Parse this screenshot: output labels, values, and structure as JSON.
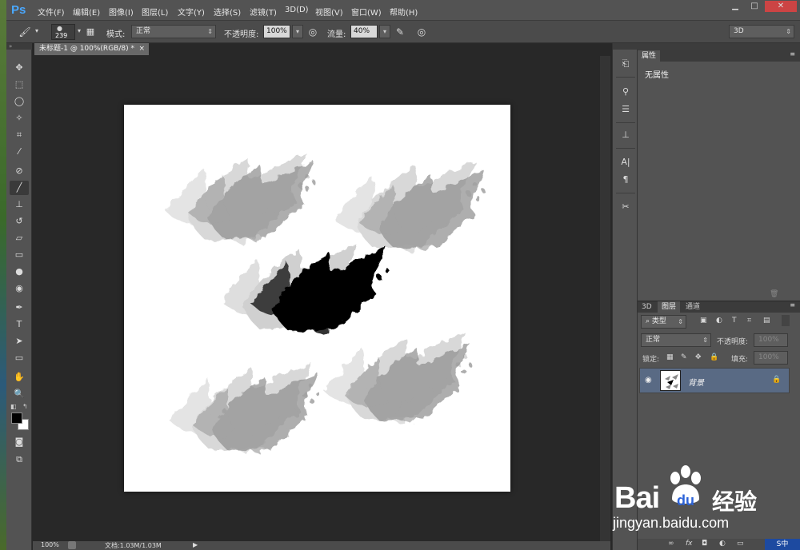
{
  "menu": {
    "logo": "Ps",
    "items": [
      "文件(F)",
      "编辑(E)",
      "图像(I)",
      "图层(L)",
      "文字(Y)",
      "选择(S)",
      "滤镜(T)",
      "3D(D)",
      "视图(V)",
      "窗口(W)",
      "帮助(H)"
    ]
  },
  "window_controls": {
    "minimize": "▁",
    "maximize": "□",
    "close": "✕"
  },
  "options": {
    "brush_size": "239",
    "mode_label": "模式:",
    "mode_value": "正常",
    "opacity_label": "不透明度:",
    "opacity_value": "100%",
    "flow_label": "流量:",
    "flow_value": "40%",
    "workspace": "3D"
  },
  "document": {
    "tab_title": "未标题-1 @ 100%(RGB/8) *",
    "close": "×"
  },
  "status": {
    "zoom": "100%",
    "doc_info": "文档:1.03M/1.03M"
  },
  "properties_panel": {
    "tab": "属性",
    "content": "无属性"
  },
  "layers_panel": {
    "tabs": [
      "3D",
      "图层",
      "通道"
    ],
    "filter_kind": "类型",
    "blend_mode": "正常",
    "opacity_label": "不透明度:",
    "opacity_value": "100%",
    "lock_label": "锁定:",
    "fill_label": "填充:",
    "fill_value": "100%",
    "layer_name": "背景"
  },
  "watermark": {
    "brand": "Bai",
    "brand2": "du",
    "cn": "经验",
    "url": "jingyan.baidu.com"
  },
  "colors": {
    "accent": "#4aa8ff",
    "ui_dark": "#282828",
    "ui_mid": "#535353",
    "layer_selected": "#596a84"
  }
}
